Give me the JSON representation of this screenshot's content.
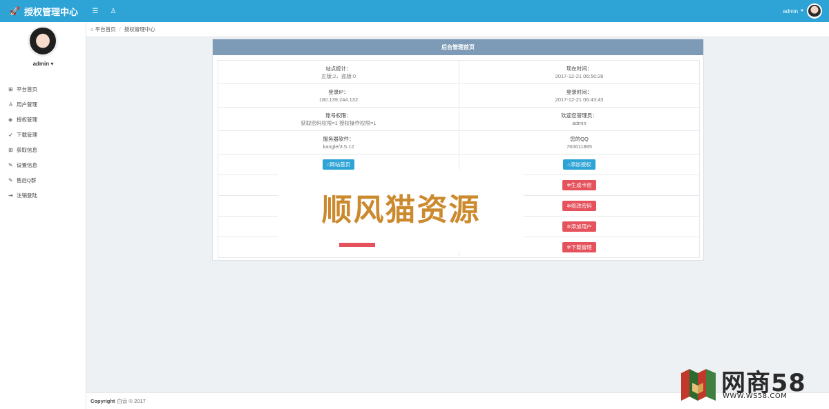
{
  "app": {
    "title": "授权管理中心"
  },
  "topbar": {
    "user": "admin"
  },
  "sidebar": {
    "user": "admin",
    "items": [
      {
        "label": "平台首页",
        "icon": "grid-icon"
      },
      {
        "label": "用户管理",
        "icon": "user-icon"
      },
      {
        "label": "授权管理",
        "icon": "layers-icon"
      },
      {
        "label": "下载管理",
        "icon": "rocket-icon"
      },
      {
        "label": "获取信息",
        "icon": "grid-icon"
      },
      {
        "label": "设置信息",
        "icon": "edit-icon"
      },
      {
        "label": "售后Q群",
        "icon": "edit-icon"
      },
      {
        "label": "注销登陆",
        "icon": "logout-icon"
      }
    ]
  },
  "breadcrumb": {
    "home": "平台首页",
    "current": "授权管理中心"
  },
  "panel": {
    "title": "后台管理首页",
    "info": [
      {
        "left_label": "站点统计：",
        "left_value": "正版:2，盗版:0",
        "right_label": "现在时间：",
        "right_value": "2017-12-21 06:56:28"
      },
      {
        "left_label": "登录IP：",
        "left_value": "180.139.244.132",
        "right_label": "登录时间：",
        "right_value": "2017-12-21 06:43:43"
      },
      {
        "left_label": "账号权限：",
        "left_value": "获取密码权限=1 授权操作权限=1",
        "right_label": "欢迎您管理员：",
        "right_value": "admin"
      },
      {
        "left_label": "服务器软件：",
        "left_value": "kangle/3.5.12",
        "right_label": "您的QQ",
        "right_value": "760611885"
      }
    ],
    "buttons": {
      "site_home": "网站首页",
      "add_auth": "添加授权",
      "gen_card": "生成卡密",
      "change_pwd": "修改密码",
      "add_user": "添加用户",
      "download": "下载管理"
    }
  },
  "watermark": {
    "text": "顺风猫资源"
  },
  "footer": {
    "copyright": "Copyright",
    "text": "白云 © 2017"
  },
  "logo": {
    "name": "网商58",
    "url": "WWW.WS58.COM"
  },
  "colors": {
    "primary": "#2ea3d6",
    "danger": "#e5525c",
    "panel_head": "#7d9bb7",
    "watermark": "#cc8a2e"
  }
}
